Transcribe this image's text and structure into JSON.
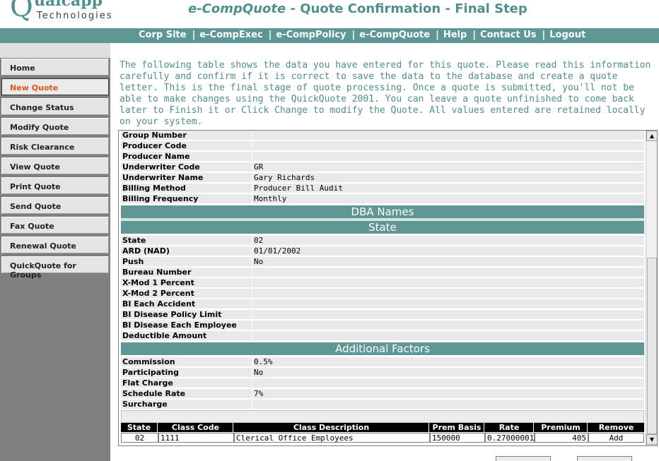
{
  "header": {
    "logo_letter": "Q",
    "logo_word": "ualcapp",
    "logo_sub": "Technologies",
    "title_brand": "e-CompQuote",
    "title_rest": " - Quote Confirmation - Final Step"
  },
  "topnav": [
    "Corp Site",
    "e-CompExec",
    "e-CompPolicy",
    "e-CompQuote",
    "Help",
    "Contact Us",
    "Logout"
  ],
  "sidebar": {
    "items": [
      "Home",
      "New Quote",
      "Change Status",
      "Modify Quote",
      "Risk Clearance",
      "View Quote",
      "Print Quote",
      "Send Quote",
      "Fax Quote",
      "Renewal Quote",
      "QuickQuote for Groups"
    ],
    "active": "New Quote"
  },
  "intro": "The following table shows the data you have entered for this quote. Please read this information carefully and confirm if it is correct to save the data to the database and create a quote letter. This is the final stage of quote processing. Once a quote is submitted, you'll not be able to make changes using the QuickQuote 2001. You can leave a quote unfinished to come back later to Finish it or Click Change to modify the Quote. All values entered are retained locally on your system.",
  "general_rows": [
    {
      "label": "Group Number",
      "value": ""
    },
    {
      "label": "Producer Code",
      "value": ""
    },
    {
      "label": "Producer Name",
      "value": ""
    },
    {
      "label": "Underwriter Code",
      "value": "GR"
    },
    {
      "label": "Underwriter Name",
      "value": "Gary  Richards"
    },
    {
      "label": "Billing Method",
      "value": "Producer Bill Audit"
    },
    {
      "label": "Billing Frequency",
      "value": "Monthly"
    }
  ],
  "sections": {
    "dba": "DBA Names",
    "state": "State",
    "additional": "Additional Factors"
  },
  "state_rows": [
    {
      "label": "State",
      "value": "02"
    },
    {
      "label": "ARD (NAD)",
      "value": "01/01/2002"
    },
    {
      "label": "Push",
      "value": "No"
    },
    {
      "label": "Bureau Number",
      "value": ""
    },
    {
      "label": "X-Mod 1 Percent",
      "value": ""
    },
    {
      "label": "X-Mod 2 Percent",
      "value": ""
    },
    {
      "label": "BI Each Accident",
      "value": ""
    },
    {
      "label": "BI Disease Policy Limit",
      "value": ""
    },
    {
      "label": "BI Disease Each Employee",
      "value": ""
    },
    {
      "label": "Deductible Amount",
      "value": ""
    }
  ],
  "factor_rows": [
    {
      "label": "Commission",
      "value": "0.5%"
    },
    {
      "label": "Participating",
      "value": "No"
    },
    {
      "label": "Flat Charge",
      "value": ""
    },
    {
      "label": "Schedule Rate",
      "value": "7%"
    },
    {
      "label": "Surcharge",
      "value": ""
    }
  ],
  "class_table": {
    "headers": [
      "State",
      "Class Code",
      "Class Description",
      "Prem Basis",
      "Rate",
      "Premium",
      "Remove"
    ],
    "rows": [
      [
        "02",
        "1111",
        "Clerical Office Employees",
        "150000",
        "0.27000001",
        "405",
        "Add"
      ]
    ]
  },
  "colors": {
    "teal": "#5e9794",
    "accent": "#e0561b"
  }
}
